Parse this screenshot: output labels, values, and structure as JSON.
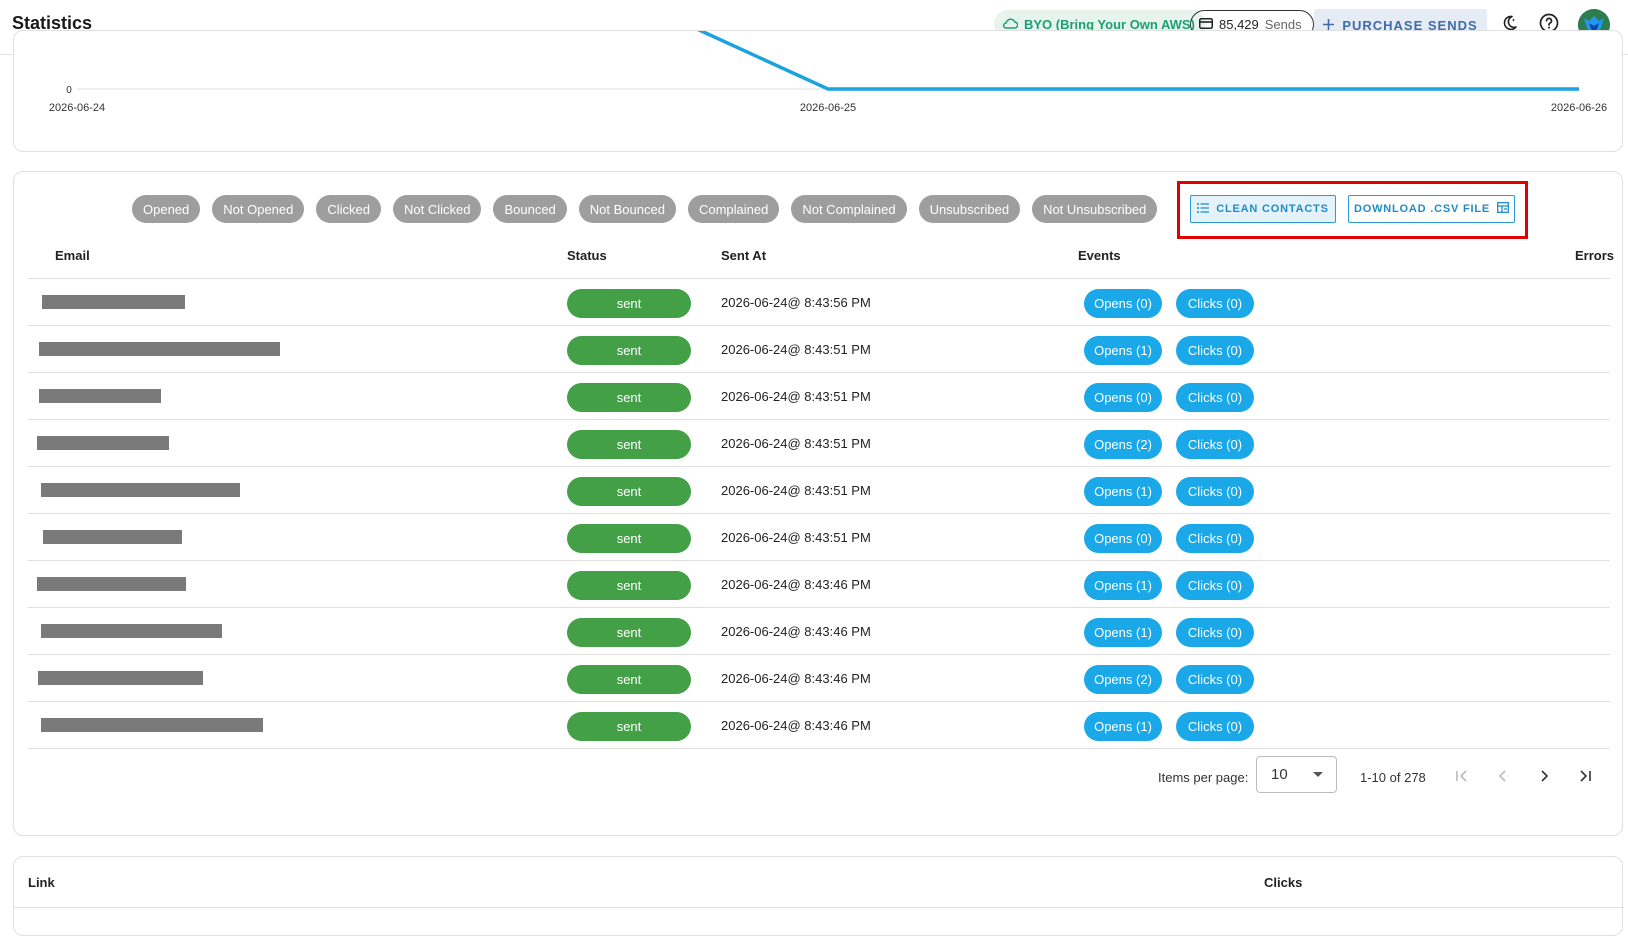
{
  "header": {
    "title": "Statistics",
    "byo_label": "BYO (Bring Your Own AWS)",
    "sends_count": "85,429",
    "sends_label": "Sends",
    "purchase_label": "PURCHASE SENDS"
  },
  "chart_data": {
    "type": "line",
    "x": [
      "2026-06-24",
      "2026-06-25",
      "2026-06-26"
    ],
    "series": [
      {
        "values": [
          null,
          0,
          0
        ]
      }
    ],
    "ytick_labels": [
      "0"
    ],
    "ylim": [
      0,
      null
    ],
    "color": "#1aa3e0"
  },
  "filters": [
    "Opened",
    "Not Opened",
    "Clicked",
    "Not Clicked",
    "Bounced",
    "Not Bounced",
    "Complained",
    "Not Complained",
    "Unsubscribed",
    "Not Unsubscribed"
  ],
  "actions": {
    "clean_label": "CLEAN CONTACTS",
    "csv_label": "DOWNLOAD .CSV FILE"
  },
  "table": {
    "columns": {
      "email": "Email",
      "status": "Status",
      "sent_at": "Sent At",
      "events": "Events",
      "errors": "Errors"
    },
    "rows": [
      {
        "status": "sent",
        "sent_at": "2026-06-24@ 8:43:56 PM",
        "opens": "Opens (0)",
        "clicks": "Clicks (0)"
      },
      {
        "status": "sent",
        "sent_at": "2026-06-24@ 8:43:51 PM",
        "opens": "Opens (1)",
        "clicks": "Clicks (0)"
      },
      {
        "status": "sent",
        "sent_at": "2026-06-24@ 8:43:51 PM",
        "opens": "Opens (0)",
        "clicks": "Clicks (0)"
      },
      {
        "status": "sent",
        "sent_at": "2026-06-24@ 8:43:51 PM",
        "opens": "Opens (2)",
        "clicks": "Clicks (0)"
      },
      {
        "status": "sent",
        "sent_at": "2026-06-24@ 8:43:51 PM",
        "opens": "Opens (1)",
        "clicks": "Clicks (0)"
      },
      {
        "status": "sent",
        "sent_at": "2026-06-24@ 8:43:51 PM",
        "opens": "Opens (0)",
        "clicks": "Clicks (0)"
      },
      {
        "status": "sent",
        "sent_at": "2026-06-24@ 8:43:46 PM",
        "opens": "Opens (1)",
        "clicks": "Clicks (0)"
      },
      {
        "status": "sent",
        "sent_at": "2026-06-24@ 8:43:46 PM",
        "opens": "Opens (1)",
        "clicks": "Clicks (0)"
      },
      {
        "status": "sent",
        "sent_at": "2026-06-24@ 8:43:46 PM",
        "opens": "Opens (2)",
        "clicks": "Clicks (0)"
      },
      {
        "status": "sent",
        "sent_at": "2026-06-24@ 8:43:46 PM",
        "opens": "Opens (1)",
        "clicks": "Clicks (0)"
      }
    ]
  },
  "pagination": {
    "items_per_page_label": "Items per page:",
    "items_per_page": "10",
    "range": "1-10 of 278"
  },
  "links_table": {
    "columns": {
      "link": "Link",
      "clicks": "Clicks"
    }
  }
}
